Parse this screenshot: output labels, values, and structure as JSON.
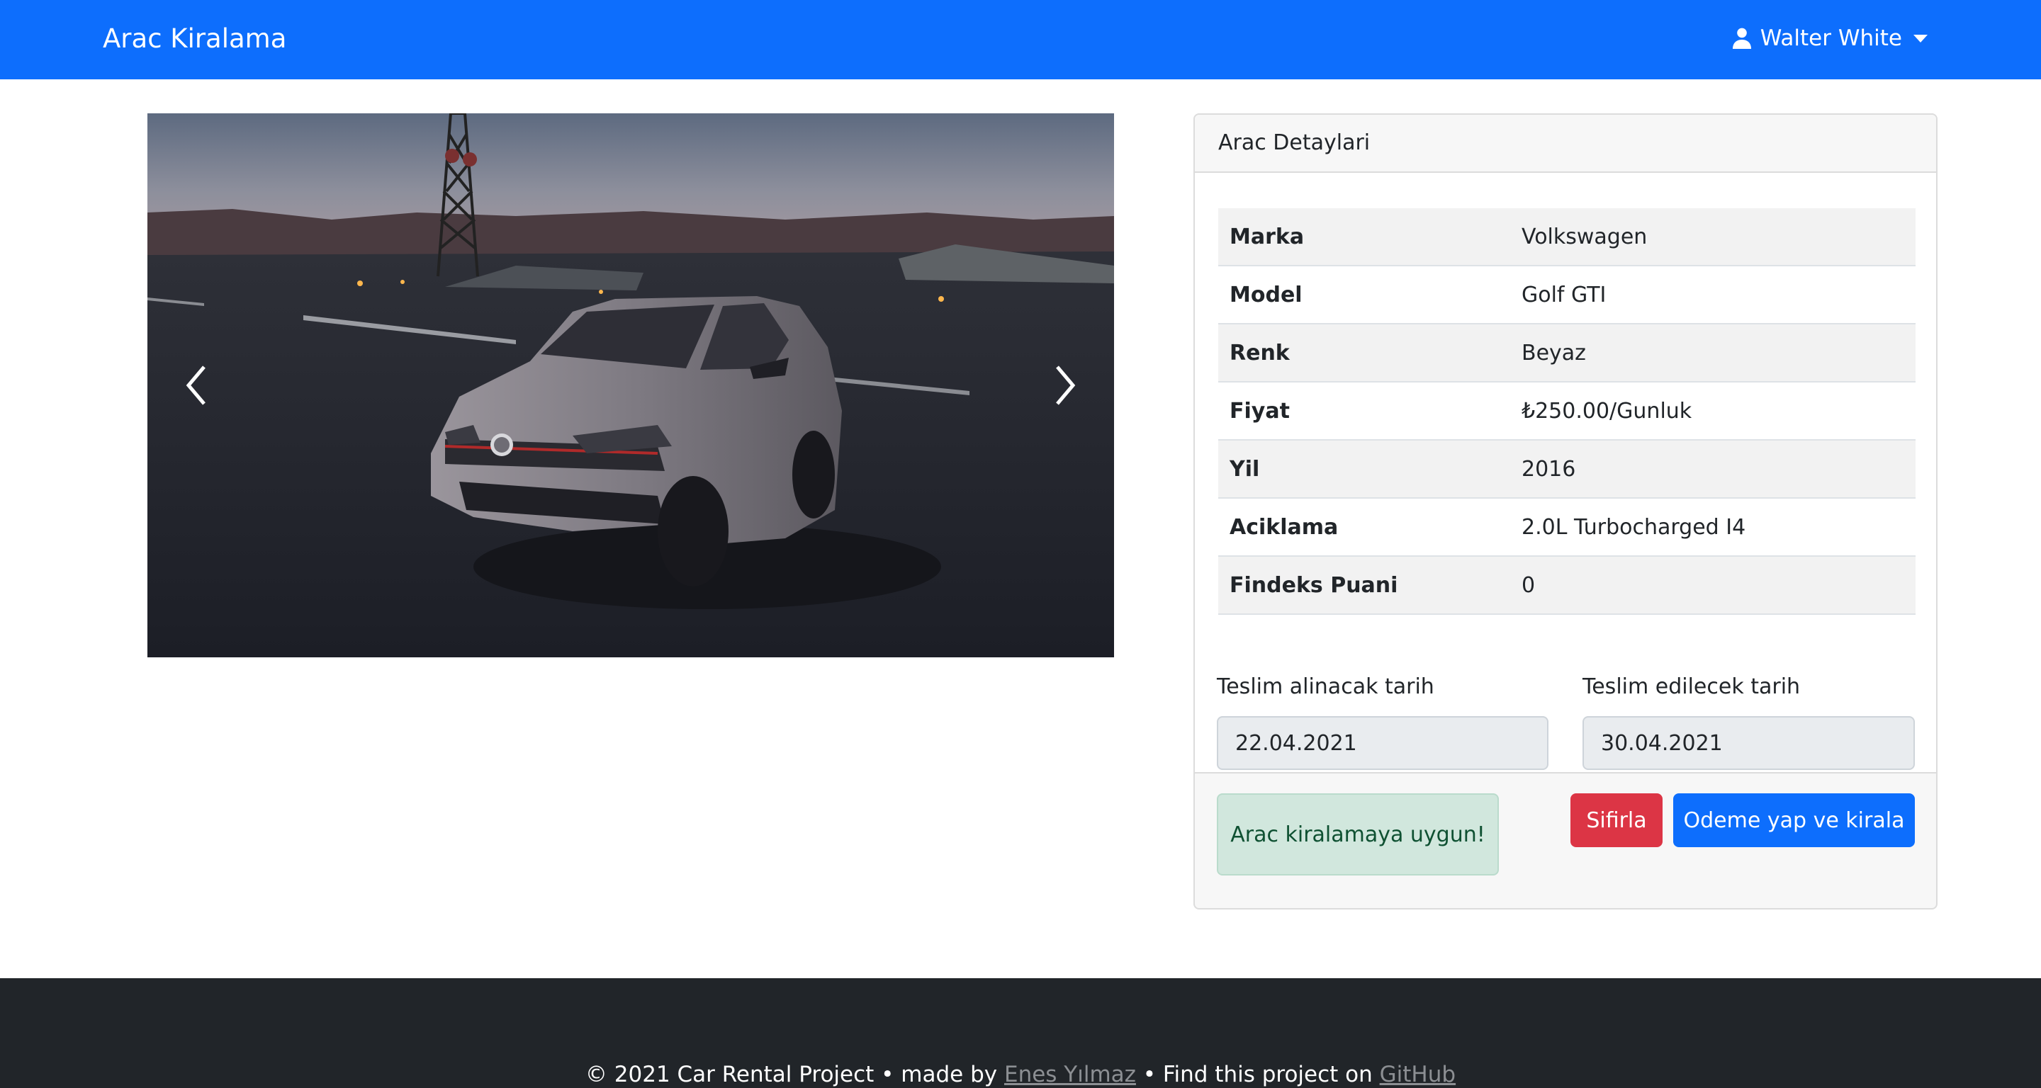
{
  "navbar": {
    "brand": "Arac Kiralama",
    "user_name": "Walter White",
    "user_icon": "person-icon",
    "bg_color": "#0d6efd"
  },
  "carousel": {
    "prev_icon": "chevron-left-icon",
    "next_icon": "chevron-right-icon"
  },
  "details_card": {
    "header": "Arac Detaylari",
    "rows": [
      {
        "label": "Marka",
        "value": "Volkswagen"
      },
      {
        "label": "Model",
        "value": "Golf GTI"
      },
      {
        "label": "Renk",
        "value": "Beyaz"
      },
      {
        "label": "Fiyat",
        "value": "₺250.00/Gunluk"
      },
      {
        "label": "Yil",
        "value": "2016"
      },
      {
        "label": "Aciklama",
        "value": "2.0L Turbocharged I4"
      },
      {
        "label": "Findeks Puani",
        "value": "0"
      }
    ]
  },
  "rental_form": {
    "pickup_label": "Teslim alinacak tarih",
    "pickup_value": "22.04.2021",
    "return_label": "Teslim edilecek tarih",
    "return_value": "30.04.2021",
    "status_message": "Arac kiralamaya uygun!",
    "reset_button": "Sifirla",
    "pay_button": "Odeme yap ve kirala",
    "colors": {
      "success_bg": "#d1e7dd",
      "danger": "#dc3545",
      "primary": "#0d6efd"
    }
  },
  "footer": {
    "copyright_prefix": "© 2021 Car Rental Project • made by ",
    "author_link": "Enes Yılmaz",
    "middle_text": " • Find this project on ",
    "github_link": "GitHub",
    "bg_color": "#212529"
  }
}
